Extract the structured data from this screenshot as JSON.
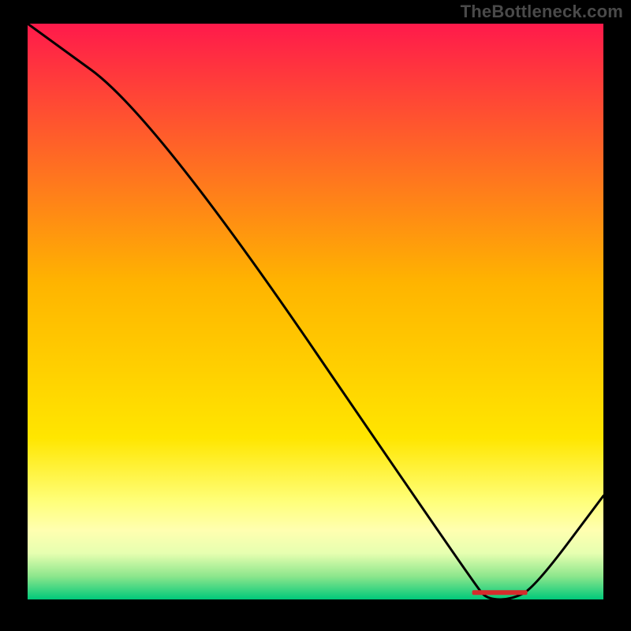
{
  "watermark": {
    "text": "TheBottleneck.com"
  },
  "chart_data": {
    "type": "line",
    "title": "",
    "xlabel": "",
    "ylabel": "",
    "xlim": [
      0,
      100
    ],
    "ylim": [
      0,
      100
    ],
    "series": [
      {
        "name": "bottleneck-curve",
        "x": [
          0,
          22,
          78,
          80,
          84,
          88,
          100
        ],
        "values": [
          100,
          84,
          2,
          0,
          0,
          2,
          18
        ]
      }
    ],
    "annotations": [
      {
        "name": "optimal-marker",
        "x_center": 82,
        "y": 1.2,
        "color": "#d62c2c"
      }
    ],
    "background": {
      "type": "vertical-gradient",
      "stops": [
        {
          "pos": 0.0,
          "color": "#ff1a4b"
        },
        {
          "pos": 0.45,
          "color": "#ffb400"
        },
        {
          "pos": 0.72,
          "color": "#ffe600"
        },
        {
          "pos": 0.83,
          "color": "#ffff7a"
        },
        {
          "pos": 0.88,
          "color": "#ffffb0"
        },
        {
          "pos": 0.92,
          "color": "#e6ffb0"
        },
        {
          "pos": 0.96,
          "color": "#8ce68c"
        },
        {
          "pos": 1.0,
          "color": "#00c97a"
        }
      ]
    }
  }
}
